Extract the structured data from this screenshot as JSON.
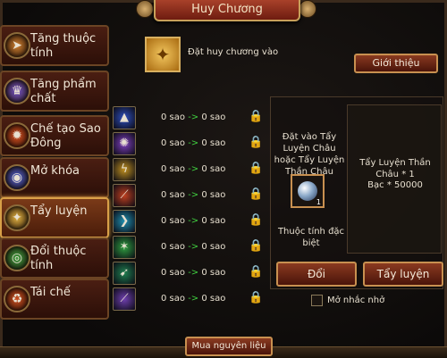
{
  "window": {
    "title": "Huy Chương"
  },
  "colors": {
    "accent": "#c89050",
    "arrow": "#40d040",
    "title_bg": "#8a2a18"
  },
  "sidebar": {
    "items": [
      {
        "label": "Tăng thuộc tính",
        "icon": "arrow-up-icon",
        "color": "#d08030"
      },
      {
        "label": "Tăng phẩm chất",
        "icon": "crown-icon",
        "color": "#7a5ac8"
      },
      {
        "label": "Chế tạo Sao Đông",
        "icon": "forge-icon",
        "color": "#d85020"
      },
      {
        "label": "Mở khóa",
        "icon": "unlock-orb-icon",
        "color": "#5060d0"
      },
      {
        "label": "Tẩy luyện",
        "icon": "refine-icon",
        "color": "#e0b040"
      },
      {
        "label": "Đổi thuộc tính",
        "icon": "swap-orb-icon",
        "color": "#40a040"
      },
      {
        "label": "Tái chế",
        "icon": "recycle-icon",
        "color": "#d05020"
      }
    ],
    "active_index": 4
  },
  "medal_slot": {
    "hint": "Đặt huy chương vào"
  },
  "intro_button": "Giới thiệu",
  "star_rows": [
    {
      "from": "0 sao",
      "arrow": "->",
      "to": "0 sao",
      "icon": "blue-gem-icon",
      "color": "#3050c0"
    },
    {
      "from": "0 sao",
      "arrow": "->",
      "to": "0 sao",
      "icon": "purple-swirl-icon",
      "color": "#8040c0"
    },
    {
      "from": "0 sao",
      "arrow": "->",
      "to": "0 sao",
      "icon": "gold-bolt-icon",
      "color": "#c09020"
    },
    {
      "from": "0 sao",
      "arrow": "->",
      "to": "0 sao",
      "icon": "red-slash-icon",
      "color": "#c04020"
    },
    {
      "from": "0 sao",
      "arrow": "->",
      "to": "0 sao",
      "icon": "cyan-wing-icon",
      "color": "#2090b0"
    },
    {
      "from": "0 sao",
      "arrow": "->",
      "to": "0 sao",
      "icon": "green-claw-icon",
      "color": "#30a040"
    },
    {
      "from": "0 sao",
      "arrow": "->",
      "to": "0 sao",
      "icon": "green-arrow-icon",
      "color": "#208050"
    },
    {
      "from": "0 sao",
      "arrow": "->",
      "to": "0 sao",
      "icon": "violet-blade-icon",
      "color": "#7040b0"
    }
  ],
  "refine_panel": {
    "instruction": "Đặt vào Tẩy Luyện Châu hoặc Tẩy Luyện Thần Châu",
    "gem_count": "1",
    "special_attr": "Thuộc tính đặc biệt",
    "cost_line1": "Tẩy Luyện Thần Châu * 1",
    "cost_line2": "Bạc * 50000"
  },
  "buttons": {
    "swap": "Đổi",
    "refine": "Tẩy luyện",
    "buy": "Mua nguyên liệu"
  },
  "reminder": {
    "label": "Mở nhắc nhở",
    "checked": false
  }
}
